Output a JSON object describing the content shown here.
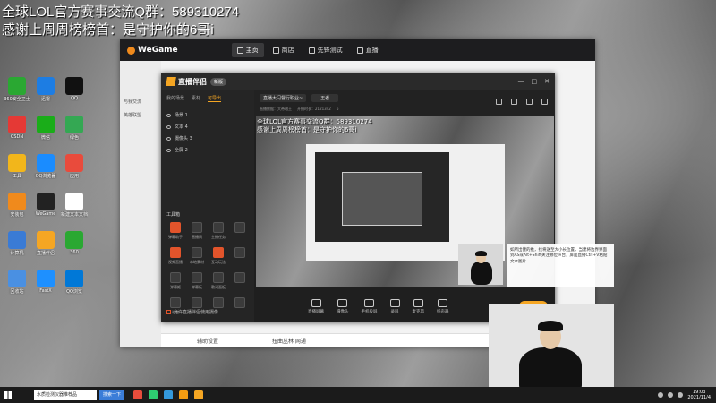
{
  "overlay": {
    "line1": "全球LOL官方赛事交流Q群：589310274",
    "line2": "感谢上周周榜榜首：是守护你的6哥i"
  },
  "desktop_icons": [
    {
      "label": "360安全卫士",
      "color": "#2aa832"
    },
    {
      "label": "迅雷",
      "color": "#1d7de3"
    },
    {
      "label": "QQ",
      "color": "#111111"
    },
    {
      "label": "CSDN",
      "color": "#e53935"
    },
    {
      "label": "微信",
      "color": "#1aad19"
    },
    {
      "label": "绿色",
      "color": "#34a853"
    },
    {
      "label": "工具",
      "color": "#f2b61b"
    },
    {
      "label": "QQ浏览器",
      "color": "#1a8cff"
    },
    {
      "label": "应用",
      "color": "#e94b3c"
    },
    {
      "label": "安装包",
      "color": "#f08a1c"
    },
    {
      "label": "WeGame",
      "color": "#222222"
    },
    {
      "label": "新建文本文档",
      "color": "#ffffff"
    },
    {
      "label": "计算机",
      "color": "#3a7bd5"
    },
    {
      "label": "直播伴侣",
      "color": "#f5a623"
    },
    {
      "label": "360",
      "color": "#2aa832"
    },
    {
      "label": "回收站",
      "color": "#4a90e2"
    },
    {
      "label": "FastX",
      "color": "#1e90ff"
    },
    {
      "label": "QQ浏览",
      "color": "#0078d7"
    }
  ],
  "wegame": {
    "logo": "WeGame",
    "tabs": [
      {
        "label": "主页",
        "active": true
      },
      {
        "label": "商店",
        "active": false
      },
      {
        "label": "先锋测试",
        "active": false
      },
      {
        "label": "直播",
        "active": false
      }
    ],
    "side_items": [
      "与我交流",
      "英雄联盟"
    ],
    "bottom": [
      "辅助设置",
      "扭曲丛林 网通"
    ]
  },
  "zhibo": {
    "logo": "直播伴侣",
    "badge": "新版",
    "left_tabs": [
      "我的场景",
      "素材",
      "可导出"
    ],
    "scenes": [
      "场景 1",
      "文本 4",
      "摄像头 3",
      "全屏 2"
    ],
    "tools_title": "工具箱",
    "tools": [
      {
        "label": "弹幕助手",
        "hot": true
      },
      {
        "label": "直播间",
        "hot": false
      },
      {
        "label": "主播任务",
        "hot": false
      },
      {
        "label": "",
        "hot": false
      },
      {
        "label": "视频直播",
        "hot": true
      },
      {
        "label": "本地素材",
        "hot": false
      },
      {
        "label": "互动玩法",
        "hot": true
      },
      {
        "label": "",
        "hot": false
      },
      {
        "label": "弹幕姬",
        "hot": false
      },
      {
        "label": "弹幕板",
        "hot": false
      },
      {
        "label": "歌词面板",
        "hot": false
      },
      {
        "label": "",
        "hot": false
      },
      {
        "label": "礼物",
        "hot": false
      },
      {
        "label": "",
        "hot": false
      },
      {
        "label": "",
        "hot": false
      },
      {
        "label": "",
        "hot": false
      }
    ],
    "live_check": "允许直播伴侣使用摄像",
    "title_input": "直播大闩督行职业~",
    "category": "王者",
    "meta": [
      "直播数据：大帝暗王",
      "开播时长：2121342",
      "6"
    ],
    "bottom_buttons": [
      "直播屏幕",
      "摄像头",
      "手机投屏",
      "录屏",
      "麦克风",
      "扬声器"
    ],
    "start_label": "开始直播"
  },
  "notice_text": "如所出健的推，找将送至大小长位置，当建将边界界面到AS或Alt+Shift关注哪位声台，屏面直播Ctrl+V粘贴文本图片",
  "taskbar": {
    "search": "水质检测仪器推荐品",
    "button": "搜索一下",
    "app_colors": [
      "#e74c3c",
      "#2ecc71",
      "#3498db",
      "#f39c12",
      "#f5a623"
    ],
    "time": "19:03",
    "date": "2021/11/4"
  }
}
